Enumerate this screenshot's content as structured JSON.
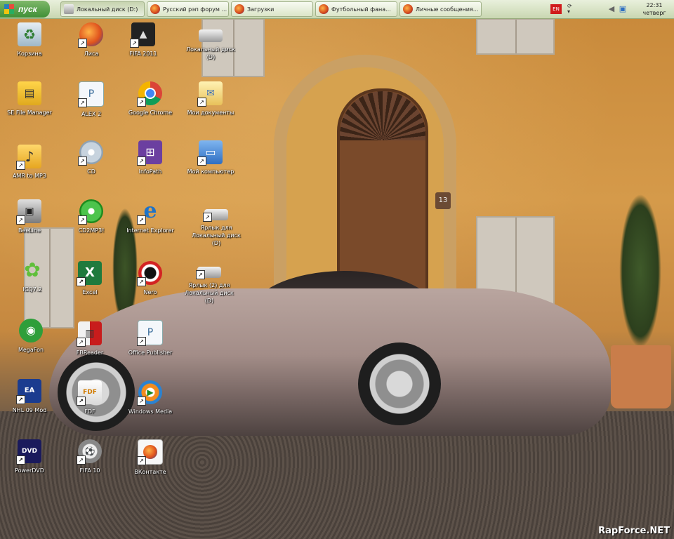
{
  "taskbar": {
    "start_label": "пуск",
    "tasks": [
      {
        "label": "Локальный диск (D:)",
        "icon": "drive-icon"
      },
      {
        "label": "Русский рэп форум ...",
        "icon": "firefox-icon"
      },
      {
        "label": "Загрузки",
        "icon": "firefox-icon"
      },
      {
        "label": "Футбольный фана...",
        "icon": "firefox-icon"
      },
      {
        "label": "Личные сообщения...",
        "icon": "firefox-icon"
      }
    ],
    "tray": {
      "language": "EN",
      "time": "22:31",
      "day": "четверг"
    }
  },
  "desktop": {
    "icons": [
      {
        "label": "Корзина",
        "icon": "recycle-bin-icon"
      },
      {
        "label": "Лиса",
        "icon": "firefox-icon"
      },
      {
        "label": "FIFA 2011",
        "icon": "fifa-icon"
      },
      {
        "label": "Локальный диск (D)",
        "icon": "drive-icon"
      },
      {
        "label": "SE File Manager",
        "icon": "file-manager-icon"
      },
      {
        "label": "ALEX 2",
        "icon": "document-icon"
      },
      {
        "label": "Google Chrome",
        "icon": "chrome-icon"
      },
      {
        "label": "Мои документы",
        "icon": "my-documents-icon"
      },
      {
        "label": "AMR to MP3",
        "icon": "music-folder-icon"
      },
      {
        "label": "CD",
        "icon": "cd-drive-icon"
      },
      {
        "label": "InfoPath",
        "icon": "infopath-icon"
      },
      {
        "label": "Мой компьютер",
        "icon": "my-computer-icon"
      },
      {
        "label": "BeeLine",
        "icon": "modem-icon"
      },
      {
        "label": "CD2MP3!",
        "icon": "cd2mp3-icon"
      },
      {
        "label": "Internet Explorer",
        "icon": "internet-explorer-icon"
      },
      {
        "label": "Ярлык для Локальный диск (D)",
        "icon": "drive-icon"
      },
      {
        "label": "ICQ7.2",
        "icon": "icq-icon"
      },
      {
        "label": "Excel",
        "icon": "excel-icon"
      },
      {
        "label": "Nero",
        "icon": "nero-icon"
      },
      {
        "label": "Ярлык (2) для Локальный диск (D)",
        "icon": "drive-icon"
      },
      {
        "label": "MegaFon",
        "icon": "megafon-icon"
      },
      {
        "label": "FBReader",
        "icon": "fbreader-icon"
      },
      {
        "label": "Office Publisher",
        "icon": "publisher-icon"
      },
      {
        "label": "NHL 09 Mod",
        "icon": "nhl-icon"
      },
      {
        "label": "FDF",
        "icon": "fdf-icon"
      },
      {
        "label": "Windows Media",
        "icon": "windows-media-icon"
      },
      {
        "label": "PowerDVD",
        "icon": "powerdvd-icon"
      },
      {
        "label": "FIFA 10",
        "icon": "fifa10-icon"
      },
      {
        "label": "ВКонтакте",
        "icon": "firefox-icon"
      }
    ]
  },
  "watermark": "RapForce.NET"
}
